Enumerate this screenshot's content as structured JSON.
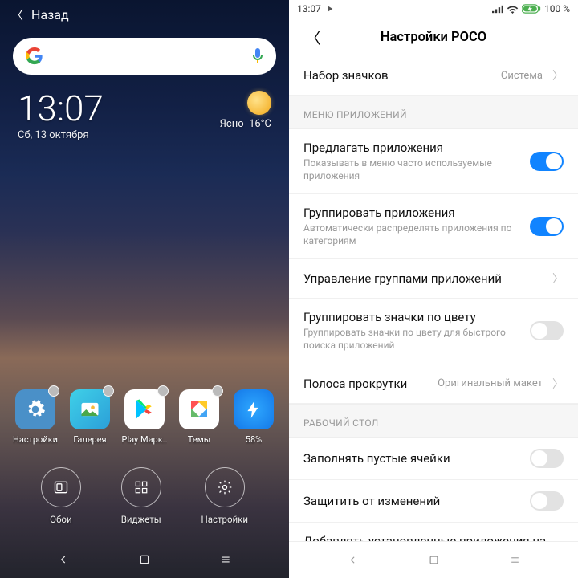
{
  "left": {
    "back_label": "Назад",
    "time": "13:07",
    "date": "Сб, 13 октября",
    "weather_label": "Ясно",
    "weather_temp": "16°C",
    "apps": [
      {
        "label": "Настройки",
        "icon": "gear-icon"
      },
      {
        "label": "Галерея",
        "icon": "gallery-icon"
      },
      {
        "label": "Play Марк..",
        "icon": "play-icon"
      },
      {
        "label": "Темы",
        "icon": "themes-icon"
      },
      {
        "label": "58%",
        "icon": "speed-icon"
      }
    ],
    "options": [
      {
        "label": "Обои",
        "icon": "wallpaper-icon"
      },
      {
        "label": "Виджеты",
        "icon": "widgets-icon"
      },
      {
        "label": "Настройки",
        "icon": "settings-icon"
      }
    ]
  },
  "right": {
    "status_time": "13:07",
    "battery_text": "100 %",
    "title": "Настройки POCO",
    "sections": {
      "apps_menu": "МЕНЮ ПРИЛОЖЕНИЙ",
      "desktop": "РАБОЧИЙ СТОЛ"
    },
    "rows": {
      "iconset": {
        "title": "Набор значков",
        "value": "Система"
      },
      "suggest": {
        "title": "Предлагать приложения",
        "sub": "Показывать в меню часто используемые приложения",
        "on": true
      },
      "group": {
        "title": "Группировать приложения",
        "sub": "Автоматически распределять приложения по категориям",
        "on": true
      },
      "manage_groups": {
        "title": "Управление группами приложений"
      },
      "group_color": {
        "title": "Группировать значки по цвету",
        "sub": "Группировать значки по цвету для быстрого поиска приложений",
        "on": false
      },
      "scrollbar": {
        "title": "Полоса прокрутки",
        "value": "Оригинальный макет"
      },
      "fill": {
        "title": "Заполнять пустые ячейки",
        "on": false
      },
      "protect": {
        "title": "Защитить от изменений",
        "on": false
      },
      "autoadd": {
        "title": "Добавлять установленные приложения на Рабочий стол автоматически"
      }
    }
  }
}
